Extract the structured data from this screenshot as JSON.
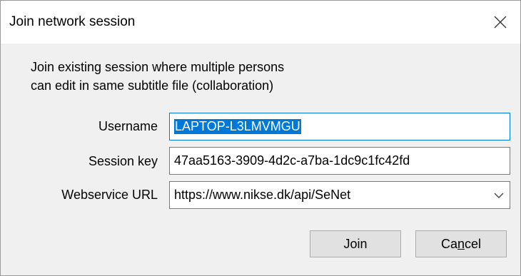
{
  "window": {
    "title": "Join network session"
  },
  "description": {
    "line1": "Join existing session where multiple persons",
    "line2": "can edit in same subtitle file (collaboration)"
  },
  "form": {
    "username_label": "Username",
    "username_value": "LAPTOP-L3LMVMGU",
    "session_key_label": "Session key",
    "session_key_value": "47aa5163-3909-4d2c-a7ba-1dc9c1fc42fd",
    "webservice_label": "Webservice URL",
    "webservice_value": "https://www.nikse.dk/api/SeNet"
  },
  "buttons": {
    "join_label": "Join",
    "cancel_label_pre": "Ca",
    "cancel_label_accel": "n",
    "cancel_label_post": "cel"
  }
}
